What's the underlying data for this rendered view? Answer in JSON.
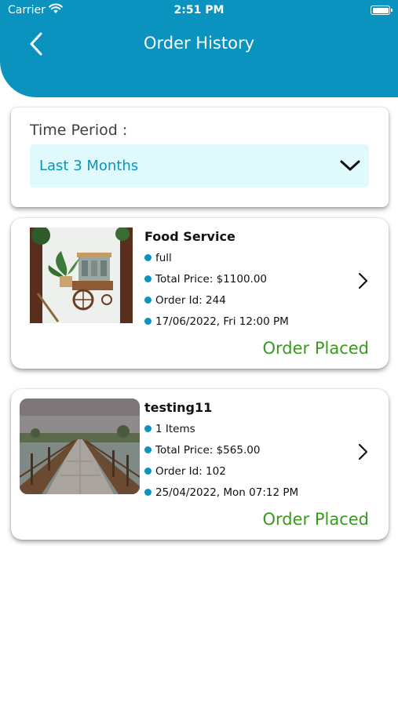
{
  "status_bar": {
    "carrier": "Carrier",
    "time": "2:51 PM"
  },
  "header": {
    "title": "Order History",
    "back_icon": "chevron-left-icon",
    "color": "#0b93c0"
  },
  "filter": {
    "label": "Time Period :",
    "selected": "Last 3 Months",
    "dropdown_icon": "chevron-down-icon"
  },
  "orders": [
    {
      "title": "Food Service",
      "line1": "full",
      "total_price": "Total Price: $1100.00",
      "order_id": "Order Id: 244",
      "date": "17/06/2022, Fri 12:00 PM",
      "status": "Order Placed"
    },
    {
      "title": "testing11",
      "line1": "1 Items",
      "total_price": "Total Price: $565.00",
      "order_id": "Order Id: 102",
      "date": "25/04/2022, Mon 07:12 PM",
      "status": "Order Placed"
    }
  ],
  "colors": {
    "accent": "#0b93c0",
    "status_green": "#3a9a1f",
    "dropdown_bg": "#dff9fc"
  }
}
